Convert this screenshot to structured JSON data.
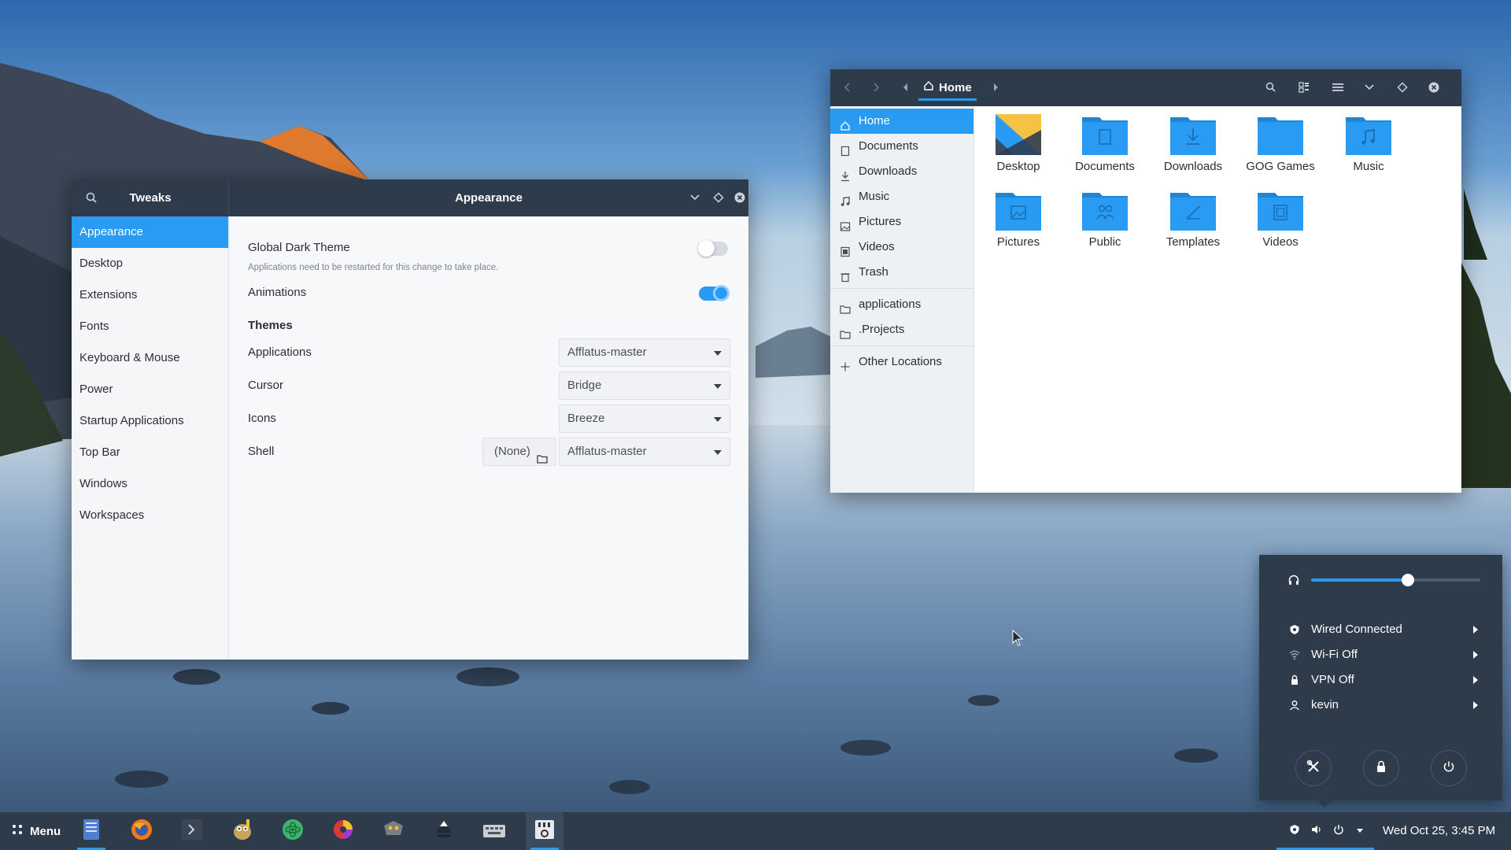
{
  "tweaks": {
    "app_title": "Tweaks",
    "page_title": "Appearance",
    "sidebar": [
      {
        "label": "Appearance",
        "active": true
      },
      {
        "label": "Desktop"
      },
      {
        "label": "Extensions"
      },
      {
        "label": "Fonts"
      },
      {
        "label": "Keyboard & Mouse"
      },
      {
        "label": "Power"
      },
      {
        "label": "Startup Applications"
      },
      {
        "label": "Top Bar"
      },
      {
        "label": "Windows"
      },
      {
        "label": "Workspaces"
      }
    ],
    "global_dark_theme": {
      "label": "Global Dark Theme",
      "note": "Applications need to be restarted for this change to take place.",
      "enabled": false
    },
    "animations": {
      "label": "Animations",
      "enabled": true
    },
    "themes_heading": "Themes",
    "themes": {
      "applications": {
        "label": "Applications",
        "value": "Afflatus-master"
      },
      "cursor": {
        "label": "Cursor",
        "value": "Bridge"
      },
      "icons": {
        "label": "Icons",
        "value": "Breeze"
      },
      "shell": {
        "label": "Shell",
        "file_button": "(None)",
        "value": "Afflatus-master"
      }
    }
  },
  "files": {
    "breadcrumb": "Home",
    "sidebar": [
      {
        "label": "Home",
        "icon": "home-icon",
        "active": true
      },
      {
        "label": "Documents",
        "icon": "document-icon"
      },
      {
        "label": "Downloads",
        "icon": "download-icon"
      },
      {
        "label": "Music",
        "icon": "music-icon"
      },
      {
        "label": "Pictures",
        "icon": "picture-icon"
      },
      {
        "label": "Videos",
        "icon": "video-icon"
      },
      {
        "label": "Trash",
        "icon": "trash-icon"
      },
      {
        "label": "applications",
        "icon": "folder-icon"
      },
      {
        "label": ".Projects",
        "icon": "folder-icon"
      },
      {
        "label": "Other Locations",
        "icon": "plus-icon"
      }
    ],
    "items": [
      {
        "label": "Desktop",
        "icon": "desktop-folder-icon"
      },
      {
        "label": "Documents",
        "icon": "documents-folder-icon"
      },
      {
        "label": "Downloads",
        "icon": "downloads-folder-icon"
      },
      {
        "label": "GOG Games",
        "icon": "folder-icon"
      },
      {
        "label": "Music",
        "icon": "music-folder-icon"
      },
      {
        "label": "Pictures",
        "icon": "pictures-folder-icon"
      },
      {
        "label": "Public",
        "icon": "public-folder-icon"
      },
      {
        "label": "Templates",
        "icon": "templates-folder-icon"
      },
      {
        "label": "Videos",
        "icon": "videos-folder-icon"
      }
    ]
  },
  "system_menu": {
    "volume_level": 0.57,
    "rows": [
      {
        "label": "Wired Connected",
        "icon": "wired-network-icon"
      },
      {
        "label": "Wi-Fi Off",
        "icon": "wifi-icon"
      },
      {
        "label": "VPN Off",
        "icon": "vpn-icon"
      },
      {
        "label": "kevin",
        "icon": "user-icon"
      }
    ],
    "actions": [
      "settings-icon",
      "lock-icon",
      "power-icon"
    ]
  },
  "panel": {
    "menu_label": "Menu",
    "clock": "Wed Oct 25,  3:45 PM",
    "launchers": [
      "files-launcher-icon",
      "firefox-icon",
      "terminal-icon",
      "gimp-icon",
      "atom-icon",
      "color-wheel-icon",
      "gnome-tweaks-icon",
      "inkscape-icon",
      "keyboard-app-icon",
      "system-monitor-icon"
    ]
  },
  "colors": {
    "accent": "#2a9bf2",
    "header": "#2e3b4b",
    "folder": "#2a9bf2"
  }
}
